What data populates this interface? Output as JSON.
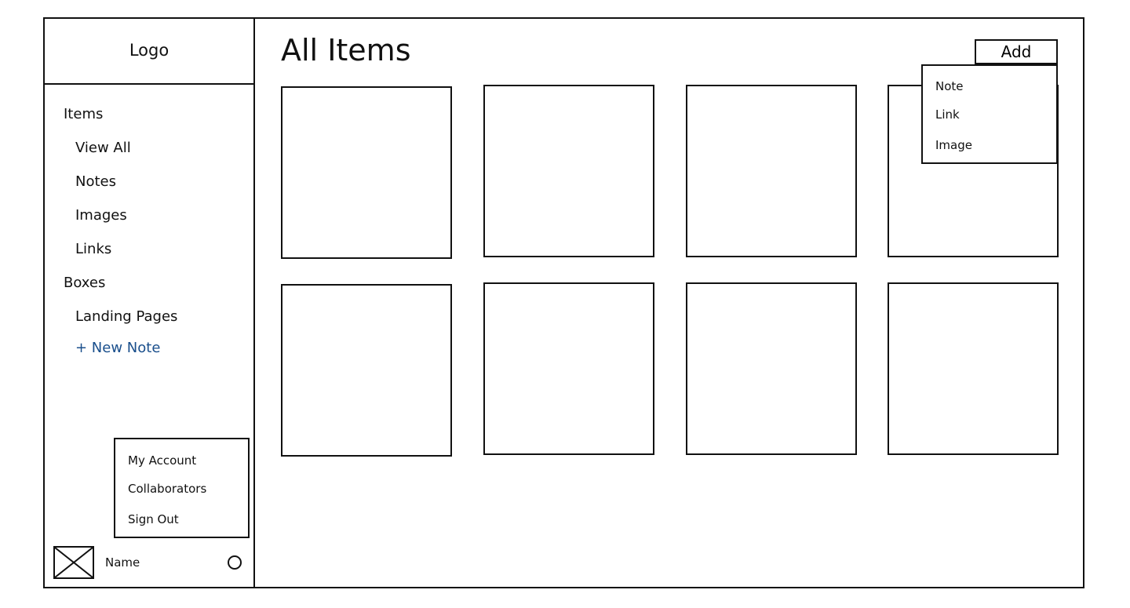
{
  "sidebar": {
    "logo": "Logo",
    "nav": [
      {
        "label": "Items",
        "indent": 0
      },
      {
        "label": "View All",
        "indent": 1
      },
      {
        "label": "Notes",
        "indent": 1
      },
      {
        "label": "Images",
        "indent": 1
      },
      {
        "label": "Links",
        "indent": 1
      },
      {
        "label": "Boxes",
        "indent": 0
      },
      {
        "label": "Landing Pages",
        "indent": 1
      },
      {
        "label": "+ New Note",
        "indent": 1
      }
    ],
    "account_menu": [
      "My Account",
      "Collaborators",
      "Sign Out"
    ],
    "user": {
      "name": "Name"
    }
  },
  "main": {
    "title": "All Items",
    "add_button": "Add",
    "add_menu": [
      "Note",
      "Link",
      "Image"
    ],
    "cards_count_rows": 2,
    "cards_per_row": 4
  },
  "colors": {
    "link": "#1a4f8c",
    "border": "#111111"
  }
}
